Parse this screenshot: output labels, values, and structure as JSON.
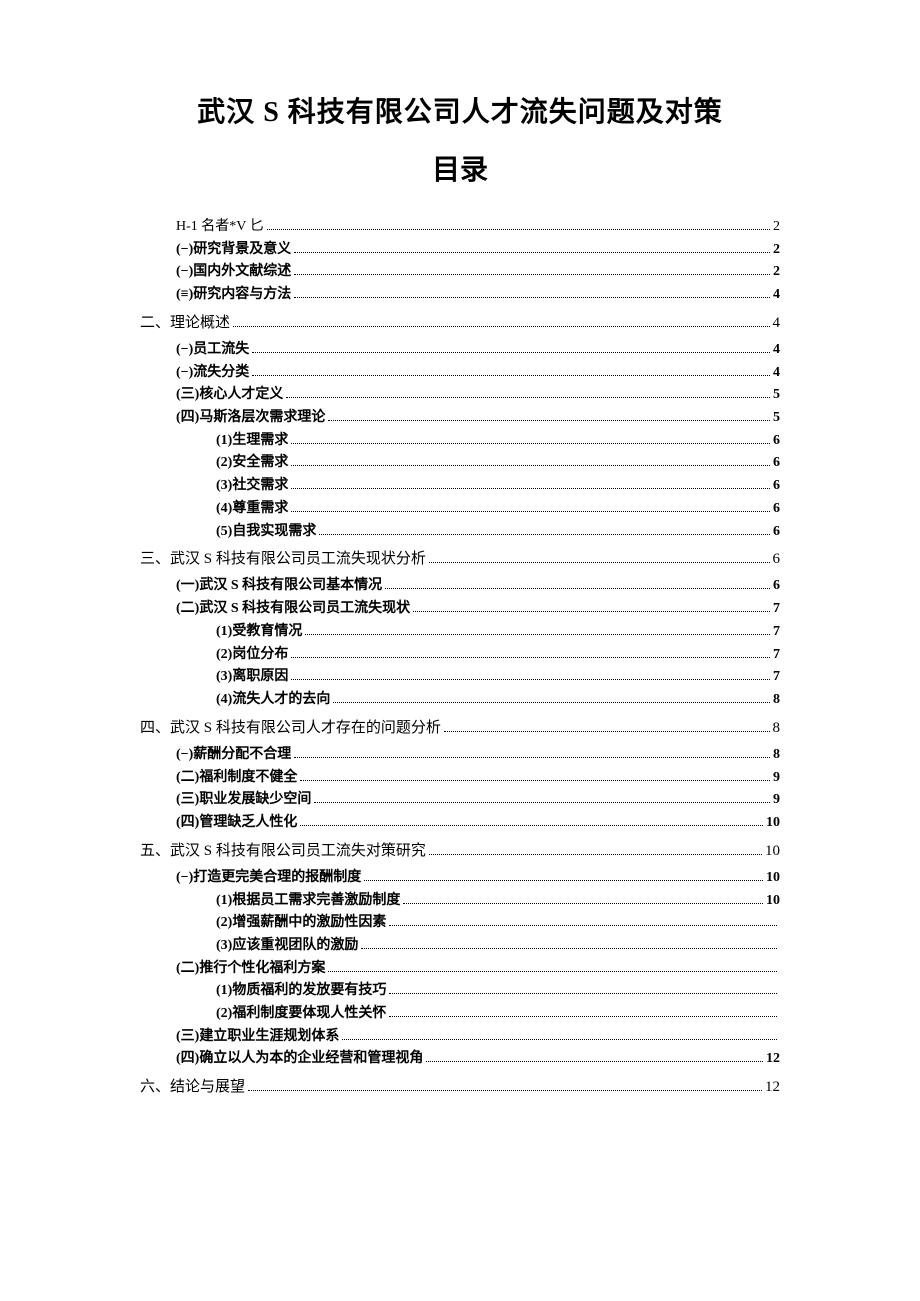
{
  "title": "武汉 S 科技有限公司人才流失问题及对策",
  "subtitle": "目录",
  "toc": [
    {
      "level": 1,
      "bold": false,
      "label": "H-1 名者*V 匕",
      "page": "2"
    },
    {
      "level": 1,
      "bold": true,
      "label": "(−)研究背景及意义",
      "page": "2"
    },
    {
      "level": 1,
      "bold": true,
      "label": "(−)国内外文献综述",
      "page": "2"
    },
    {
      "level": 1,
      "bold": true,
      "label": "(≡)研究内容与方法",
      "page": "4"
    },
    {
      "level": 0,
      "section": true,
      "label": "二、理论概述",
      "page": "4"
    },
    {
      "level": 1,
      "bold": true,
      "label": "(−)员工流失",
      "page": "4"
    },
    {
      "level": 1,
      "bold": true,
      "label": "(−)流失分类",
      "page": "4"
    },
    {
      "level": 1,
      "bold": true,
      "label": "(三)核心人才定义",
      "page": "5"
    },
    {
      "level": 1,
      "bold": true,
      "label": "(四)马斯洛层次需求理论",
      "page": "5"
    },
    {
      "level": 2,
      "bold": true,
      "label": "(1)生理需求",
      "page": "6"
    },
    {
      "level": 2,
      "bold": true,
      "label": "(2)安全需求",
      "page": "6"
    },
    {
      "level": 2,
      "bold": true,
      "label": "(3)社交需求",
      "page": "6"
    },
    {
      "level": 2,
      "bold": true,
      "label": "(4)尊重需求",
      "page": "6"
    },
    {
      "level": 2,
      "bold": true,
      "label": "(5)自我实现需求",
      "page": "6"
    },
    {
      "level": 0,
      "section": true,
      "label": "三、武汉 S 科技有限公司员工流失现状分析",
      "page": "6"
    },
    {
      "level": 1,
      "bold": true,
      "label": "(一)武汉 S 科技有限公司基本情况",
      "page": "6"
    },
    {
      "level": 1,
      "bold": true,
      "label": "(二)武汉 S 科技有限公司员工流失现状",
      "page": "7"
    },
    {
      "level": 2,
      "bold": true,
      "label": "(1)受教育情况",
      "page": "7"
    },
    {
      "level": 2,
      "bold": true,
      "label": "(2)岗位分布",
      "page": "7"
    },
    {
      "level": 2,
      "bold": true,
      "label": "(3)离职原因",
      "page": "7"
    },
    {
      "level": 2,
      "bold": true,
      "label": "(4)流失人才的去向",
      "page": "8"
    },
    {
      "level": 0,
      "section": true,
      "label": "四、武汉 S 科技有限公司人才存在的问题分析",
      "page": "8"
    },
    {
      "level": 1,
      "bold": true,
      "label": "(−)薪酬分配不合理",
      "page": "8"
    },
    {
      "level": 1,
      "bold": true,
      "label": "(二)福利制度不健全",
      "page": "9"
    },
    {
      "level": 1,
      "bold": true,
      "label": "(三)职业发展缺少空间",
      "page": "9"
    },
    {
      "level": 1,
      "bold": true,
      "label": "(四)管理缺乏人性化",
      "page": "10"
    },
    {
      "level": 0,
      "section": true,
      "label": "五、武汉 S 科技有限公司员工流失对策研究",
      "page": "10"
    },
    {
      "level": 1,
      "bold": true,
      "label": "(−)打造更完美合理的报酬制度",
      "page": "10"
    },
    {
      "level": 2,
      "bold": true,
      "label": "(1)根据员工需求完善激励制度",
      "page": "10"
    },
    {
      "level": 2,
      "bold": true,
      "label": "(2)增强薪酬中的激励性因素",
      "page": ""
    },
    {
      "level": 2,
      "bold": true,
      "label": "(3)应该重视团队的激励",
      "page": ""
    },
    {
      "level": 1,
      "bold": true,
      "label": "(二)推行个性化福利方案",
      "page": ""
    },
    {
      "level": 2,
      "bold": true,
      "label": "(1)物质福利的发放要有技巧",
      "page": ""
    },
    {
      "level": 2,
      "bold": true,
      "label": "(2)福利制度要体现人性关怀",
      "page": ""
    },
    {
      "level": 1,
      "bold": true,
      "label": "(三)建立职业生涯规划体系",
      "page": ""
    },
    {
      "level": 1,
      "bold": true,
      "label": "(四)确立以人为本的企业经营和管理视角",
      "page": "12"
    },
    {
      "level": 0,
      "section": true,
      "label": "六、结论与展望",
      "page": "12"
    }
  ]
}
